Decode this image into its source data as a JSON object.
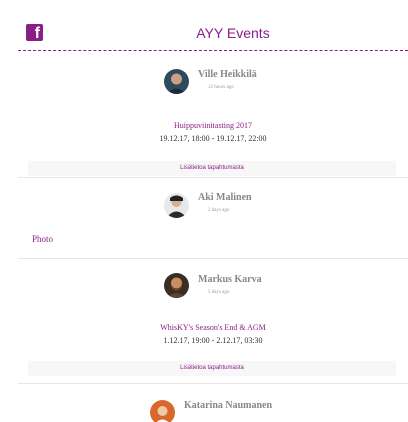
{
  "header": {
    "icon": "facebook-icon",
    "title": "AYY Events"
  },
  "posts": [
    {
      "author": "Ville Heikkilä",
      "time": "12 hours ago",
      "event_title": "Huippuviinitasting 2017",
      "event_dates": "19.12.17, 18:00 - 19.12.17, 22:00",
      "link_label": "Lisätietoa tapahtumasta"
    },
    {
      "author": "Aki Malinen",
      "time": "2 days ago",
      "content_label": "Photo"
    },
    {
      "author": "Markus Karva",
      "time": "5 days ago",
      "event_title": "WhisKY's Season's End & AGM",
      "event_dates": "1.12.17, 19:00 - 2.12.17, 03:30",
      "link_label": "Lisätietoa tapahtumasta"
    },
    {
      "author": "Katarina Naumanen"
    }
  ],
  "colors": {
    "accent": "#8b1d86",
    "link_bg": "#f7f7f7",
    "author_text": "#888888"
  }
}
